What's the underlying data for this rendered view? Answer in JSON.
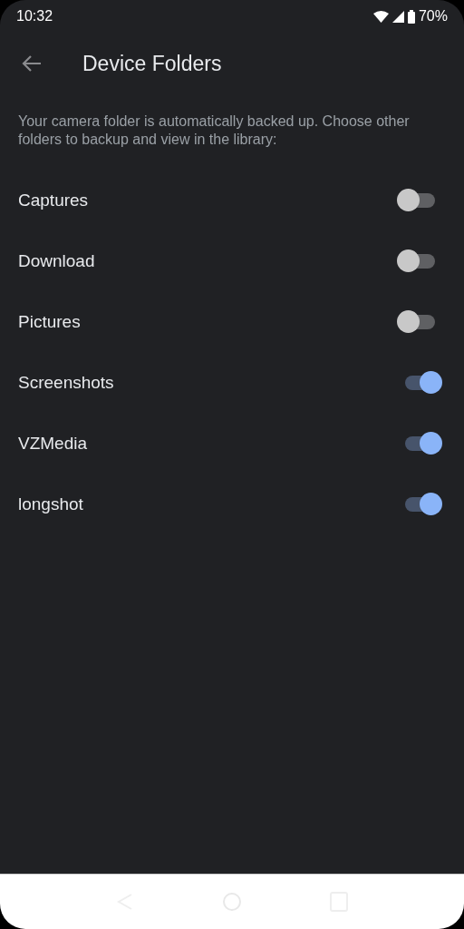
{
  "status_bar": {
    "time": "10:32",
    "battery": "70%"
  },
  "toolbar": {
    "title": "Device Folders"
  },
  "description": "Your camera folder is automatically backed up. Choose other folders to backup and view in the library:",
  "folders": [
    {
      "name": "Captures",
      "on": false
    },
    {
      "name": "Download",
      "on": false
    },
    {
      "name": "Pictures",
      "on": false
    },
    {
      "name": "Screenshots",
      "on": true
    },
    {
      "name": "VZMedia",
      "on": true
    },
    {
      "name": "longshot",
      "on": true
    }
  ]
}
